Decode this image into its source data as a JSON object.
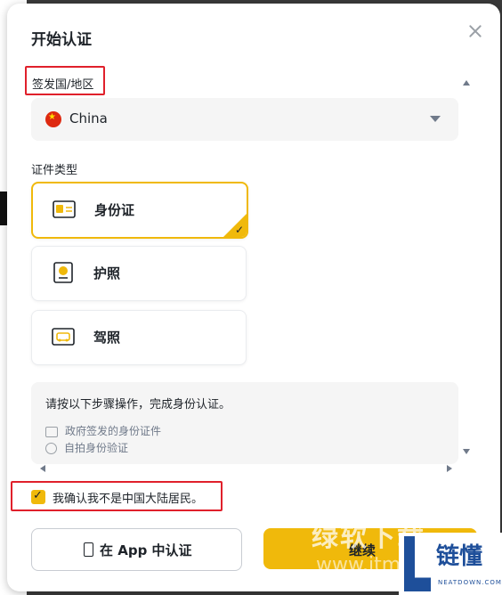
{
  "dialog": {
    "title": "开始认证",
    "issuer_label": "签发国/地区",
    "country": {
      "flag_icon": "china-flag-icon",
      "value": "China"
    },
    "doc_type_label": "证件类型",
    "doc_types": [
      {
        "label": "身份证",
        "icon": "id-card-icon",
        "selected": true
      },
      {
        "label": "护照",
        "icon": "passport-icon",
        "selected": false
      },
      {
        "label": "驾照",
        "icon": "driver-license-icon",
        "selected": false
      }
    ],
    "info": {
      "title": "请按以下步骤操作，完成身份认证。",
      "steps": [
        {
          "icon": "id-document-icon",
          "text": "政府签发的身份证件"
        },
        {
          "icon": "selfie-icon",
          "text": "自拍身份验证"
        }
      ]
    },
    "confirm": {
      "checked": true,
      "label": "我确认我不是中国大陆居民。"
    },
    "buttons": {
      "app": "在 App 中认证",
      "continue": "继续"
    }
  },
  "watermark": {
    "text": "绿软下载",
    "url": "www.itm"
  },
  "logo": {
    "text": "链懂",
    "sub": "NEATDOWN.COM"
  },
  "colors": {
    "accent": "#f0b90b",
    "highlight": "#e0202b",
    "text": "#1e2329"
  }
}
